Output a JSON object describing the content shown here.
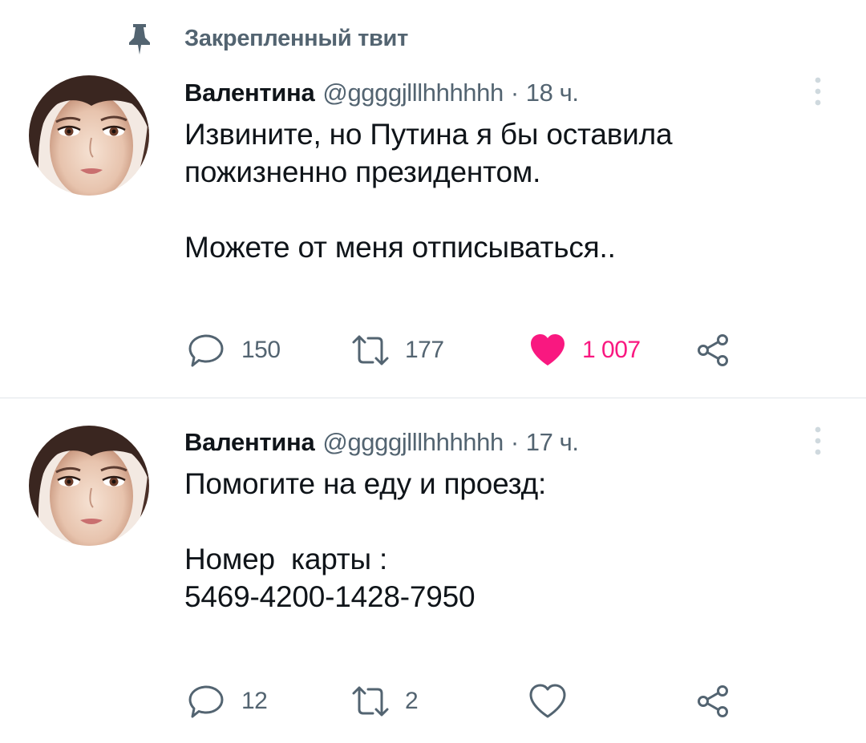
{
  "pinned": {
    "label": "Закрепленный твит",
    "icon": "pin-icon"
  },
  "colors": {
    "text_primary": "#0f1419",
    "text_secondary": "#536471",
    "like_active": "#f91880",
    "divider": "#e1e6ea"
  },
  "tweets": [
    {
      "author": {
        "name": "Валентина",
        "handle": "@ggggjlllhhhhhh"
      },
      "dot": "·",
      "time": "18 ч.",
      "text_lines": [
        "Извините, но Путина я бы оставила",
        "пожизненно президентом.",
        "",
        "Можете от меня отписываться.."
      ],
      "actions": {
        "replies": "150",
        "retweets": "177",
        "likes": "1 007",
        "liked": true
      }
    },
    {
      "author": {
        "name": "Валентина",
        "handle": "@ggggjlllhhhhhh"
      },
      "dot": "·",
      "time": "17 ч.",
      "text_lines": [
        "Помогите на еду и проезд:",
        "",
        "Номер  карты :",
        "5469-4200-1428-7950"
      ],
      "actions": {
        "replies": "12",
        "retweets": "2",
        "likes": "",
        "liked": false
      }
    }
  ]
}
